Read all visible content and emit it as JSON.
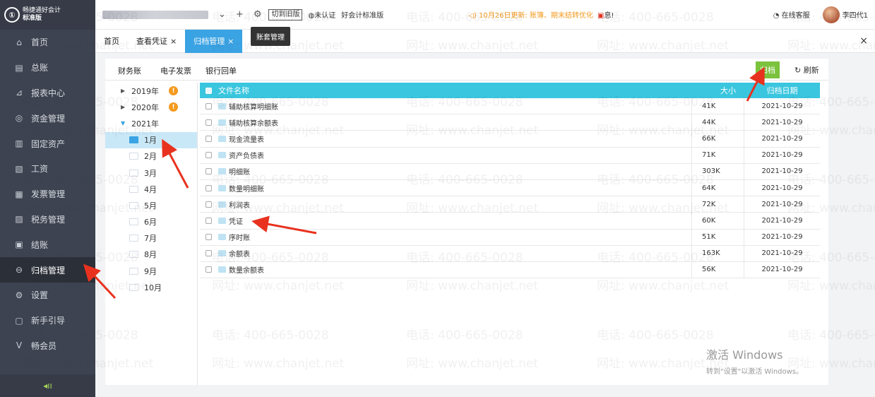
{
  "app": {
    "logo_text_line1": "畅捷通好会计",
    "logo_text_line2": "标准版"
  },
  "sidebar": {
    "items": [
      {
        "label": "首页",
        "icon": "home-icon",
        "glyph": "⌂"
      },
      {
        "label": "总账",
        "icon": "ledger-icon",
        "glyph": "▤"
      },
      {
        "label": "报表中心",
        "icon": "chart-icon",
        "glyph": "⊿"
      },
      {
        "label": "资金管理",
        "icon": "money-icon",
        "glyph": "◎"
      },
      {
        "label": "固定资产",
        "icon": "asset-icon",
        "glyph": "▥"
      },
      {
        "label": "工资",
        "icon": "salary-icon",
        "glyph": "▧"
      },
      {
        "label": "发票管理",
        "icon": "invoice-icon",
        "glyph": "▦"
      },
      {
        "label": "税务管理",
        "icon": "tax-icon",
        "glyph": "▨"
      },
      {
        "label": "结账",
        "icon": "checkout-icon",
        "glyph": "▣"
      },
      {
        "label": "归档管理",
        "icon": "archive-icon",
        "glyph": "⊖"
      },
      {
        "label": "设置",
        "icon": "gear-icon",
        "glyph": "⚙"
      },
      {
        "label": "新手引导",
        "icon": "guide-icon",
        "glyph": "▢"
      },
      {
        "label": "畅会员",
        "icon": "vip-icon",
        "glyph": "V"
      }
    ],
    "active_index": 9,
    "collapse_glyph": "◂ıı"
  },
  "topbar": {
    "switch_old_label": "切到旧版",
    "cert_label": "未认证",
    "edition_label": "好会计标准版",
    "notice": "10月26日更新: 账簿、期末结转优化",
    "message_label": "息!",
    "online_service": "在线客服",
    "user_name": "李四代1",
    "plus_glyph": "+",
    "settings_glyph": "⚙",
    "dropdown_glyph": "⌄",
    "speaker_glyph": "◁)"
  },
  "tabs": {
    "items": [
      {
        "label": "首页",
        "closable": false
      },
      {
        "label": "查看凭证",
        "closable": true
      },
      {
        "label": "归档管理",
        "closable": true
      }
    ],
    "active_index": 2,
    "tooltip": "账套管理",
    "close_all_glyph": "×"
  },
  "panel": {
    "subtabs": [
      "财务账",
      "电子发票",
      "银行回单"
    ],
    "active_subtab": 0,
    "archive_button": "归档",
    "refresh_button": "刷新"
  },
  "tree": {
    "years": [
      {
        "label": "2019年",
        "expanded": false,
        "warn": true
      },
      {
        "label": "2020年",
        "expanded": false,
        "warn": true
      },
      {
        "label": "2021年",
        "expanded": true,
        "warn": false
      }
    ],
    "months": [
      "1月",
      "2月",
      "3月",
      "4月",
      "5月",
      "6月",
      "7月",
      "8月",
      "9月",
      "10月"
    ],
    "selected_month": 0,
    "warn_glyph": "!"
  },
  "table": {
    "headers": {
      "name": "文件名称",
      "size": "大小",
      "date": "归档日期"
    },
    "rows": [
      {
        "name": "辅助核算明细账",
        "size": "41K",
        "date": "2021-10-29"
      },
      {
        "name": "辅助核算余额表",
        "size": "44K",
        "date": "2021-10-29"
      },
      {
        "name": "现金流量表",
        "size": "66K",
        "date": "2021-10-29"
      },
      {
        "name": "资产负债表",
        "size": "71K",
        "date": "2021-10-29"
      },
      {
        "name": "明细账",
        "size": "303K",
        "date": "2021-10-29"
      },
      {
        "name": "数量明细账",
        "size": "64K",
        "date": "2021-10-29"
      },
      {
        "name": "利润表",
        "size": "72K",
        "date": "2021-10-29"
      },
      {
        "name": "凭证",
        "size": "60K",
        "date": "2021-10-29"
      },
      {
        "name": "序时账",
        "size": "51K",
        "date": "2021-10-29"
      },
      {
        "name": "余额表",
        "size": "163K",
        "date": "2021-10-29"
      },
      {
        "name": "数量余额表",
        "size": "56K",
        "date": "2021-10-29"
      }
    ]
  },
  "watermark": {
    "phone": "电话: 400-665-0028",
    "site": "网址: www.chanjet.net"
  },
  "windows_activation": {
    "line1": "激活 Windows",
    "line2": "转到\"设置\"以激活 Windows。"
  },
  "colors": {
    "sidebar_bg": "#3d4350",
    "accent_blue": "#3aa3e3",
    "table_header": "#3ac6de",
    "archive_green": "#7bc23d",
    "warn_orange": "#f39a1e",
    "arrow_red": "#e8321f"
  }
}
